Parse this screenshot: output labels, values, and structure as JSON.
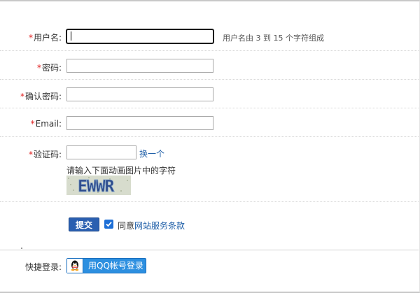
{
  "form": {
    "username": {
      "required_mark": "*",
      "label": "用户名:",
      "value": "",
      "hint": "用户名由 3 到 15 个字符组成"
    },
    "password": {
      "required_mark": "*",
      "label": "密码:",
      "value": ""
    },
    "confirm_password": {
      "required_mark": "*",
      "label": "确认密码:",
      "value": ""
    },
    "email": {
      "required_mark": "*",
      "label": "Email:",
      "value": ""
    },
    "captcha": {
      "required_mark": "*",
      "label": "验证码:",
      "value": "",
      "refresh_link": "换一个",
      "instruction": "请输入下面动画图片中的字符",
      "image_text": "EWWR"
    },
    "submit_label": "提交",
    "agree_checked": true,
    "agree_prefix": "同意",
    "agree_link": "网站服务条款"
  },
  "quick_login": {
    "label": "快捷登录:",
    "qq_button_label": "用QQ帐号登录"
  },
  "colors": {
    "required": "#e02020",
    "link": "#1f5fa8",
    "submit_button": "#2a5fb0",
    "qq_button": "#2c8fe0",
    "checkbox": "#1d6fd6"
  }
}
